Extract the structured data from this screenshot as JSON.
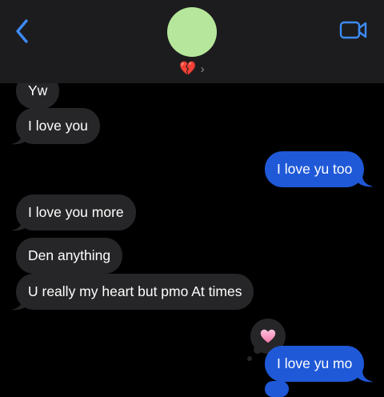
{
  "header": {
    "contact_name": "💔",
    "chevron": "›",
    "back_icon": "chevron-left-icon",
    "video_icon": "video-camera-icon",
    "avatar_color": "#b5e69b",
    "accent_color": "#3d8bf7"
  },
  "messages": [
    {
      "direction": "received",
      "text": "Yw"
    },
    {
      "direction": "received",
      "text": "I love you"
    },
    {
      "direction": "sent",
      "text": "I love yu too"
    },
    {
      "direction": "received",
      "text": "I love you more"
    },
    {
      "direction": "received",
      "text": "Den anything"
    },
    {
      "direction": "received",
      "text": "U really my heart but pmo At times"
    },
    {
      "direction": "sent",
      "text": "I love yu mo",
      "tapback": "heart"
    }
  ],
  "colors": {
    "sent_bubble": "#1f59d8",
    "received_bubble": "#262628",
    "background": "#000000"
  }
}
